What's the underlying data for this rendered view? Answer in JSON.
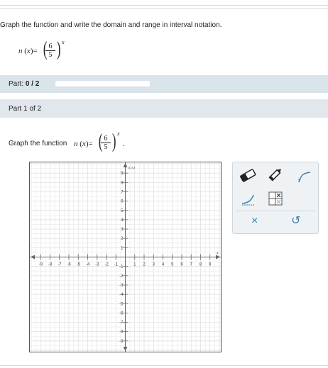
{
  "question": {
    "prompt": "Graph the function and write the domain and range in interval notation.",
    "function_name": "n",
    "variable": "x",
    "base_numerator": "6",
    "base_denominator": "5",
    "exponent": "x"
  },
  "part_bar": {
    "label": "Part: ",
    "progress": "0 / 2",
    "progress_fraction": 0
  },
  "part_header": {
    "label": "Part 1 of 2"
  },
  "graph_prompt": {
    "text": "Graph the function"
  },
  "graph": {
    "y_axis_label": "n (x)",
    "x_axis_label": "x",
    "x_ticks": [
      "-9",
      "-8",
      "-7",
      "-6",
      "-5",
      "-4",
      "-3",
      "-2",
      "-1",
      "1",
      "2",
      "3",
      "4",
      "5",
      "6",
      "7",
      "8",
      "9"
    ],
    "y_ticks": [
      "9",
      "8",
      "7",
      "6",
      "5",
      "4",
      "3",
      "2",
      "1",
      "-1",
      "-2",
      "-3",
      "-4",
      "-5",
      "-6",
      "-7",
      "-8",
      "-9"
    ],
    "xlim": [
      -10,
      10
    ],
    "ylim": [
      -10,
      10
    ],
    "grid": true
  },
  "toolbar": {
    "tools": [
      "eraser-icon",
      "pencil-icon",
      "exponential-curve-icon",
      "exponential-decay-icon",
      "table-icon"
    ],
    "clear_label": "×",
    "undo_label": "↺"
  },
  "colors": {
    "accent": "#4ba0d4",
    "icon": "#3f7fa8",
    "bar": "#d9e3ea"
  }
}
